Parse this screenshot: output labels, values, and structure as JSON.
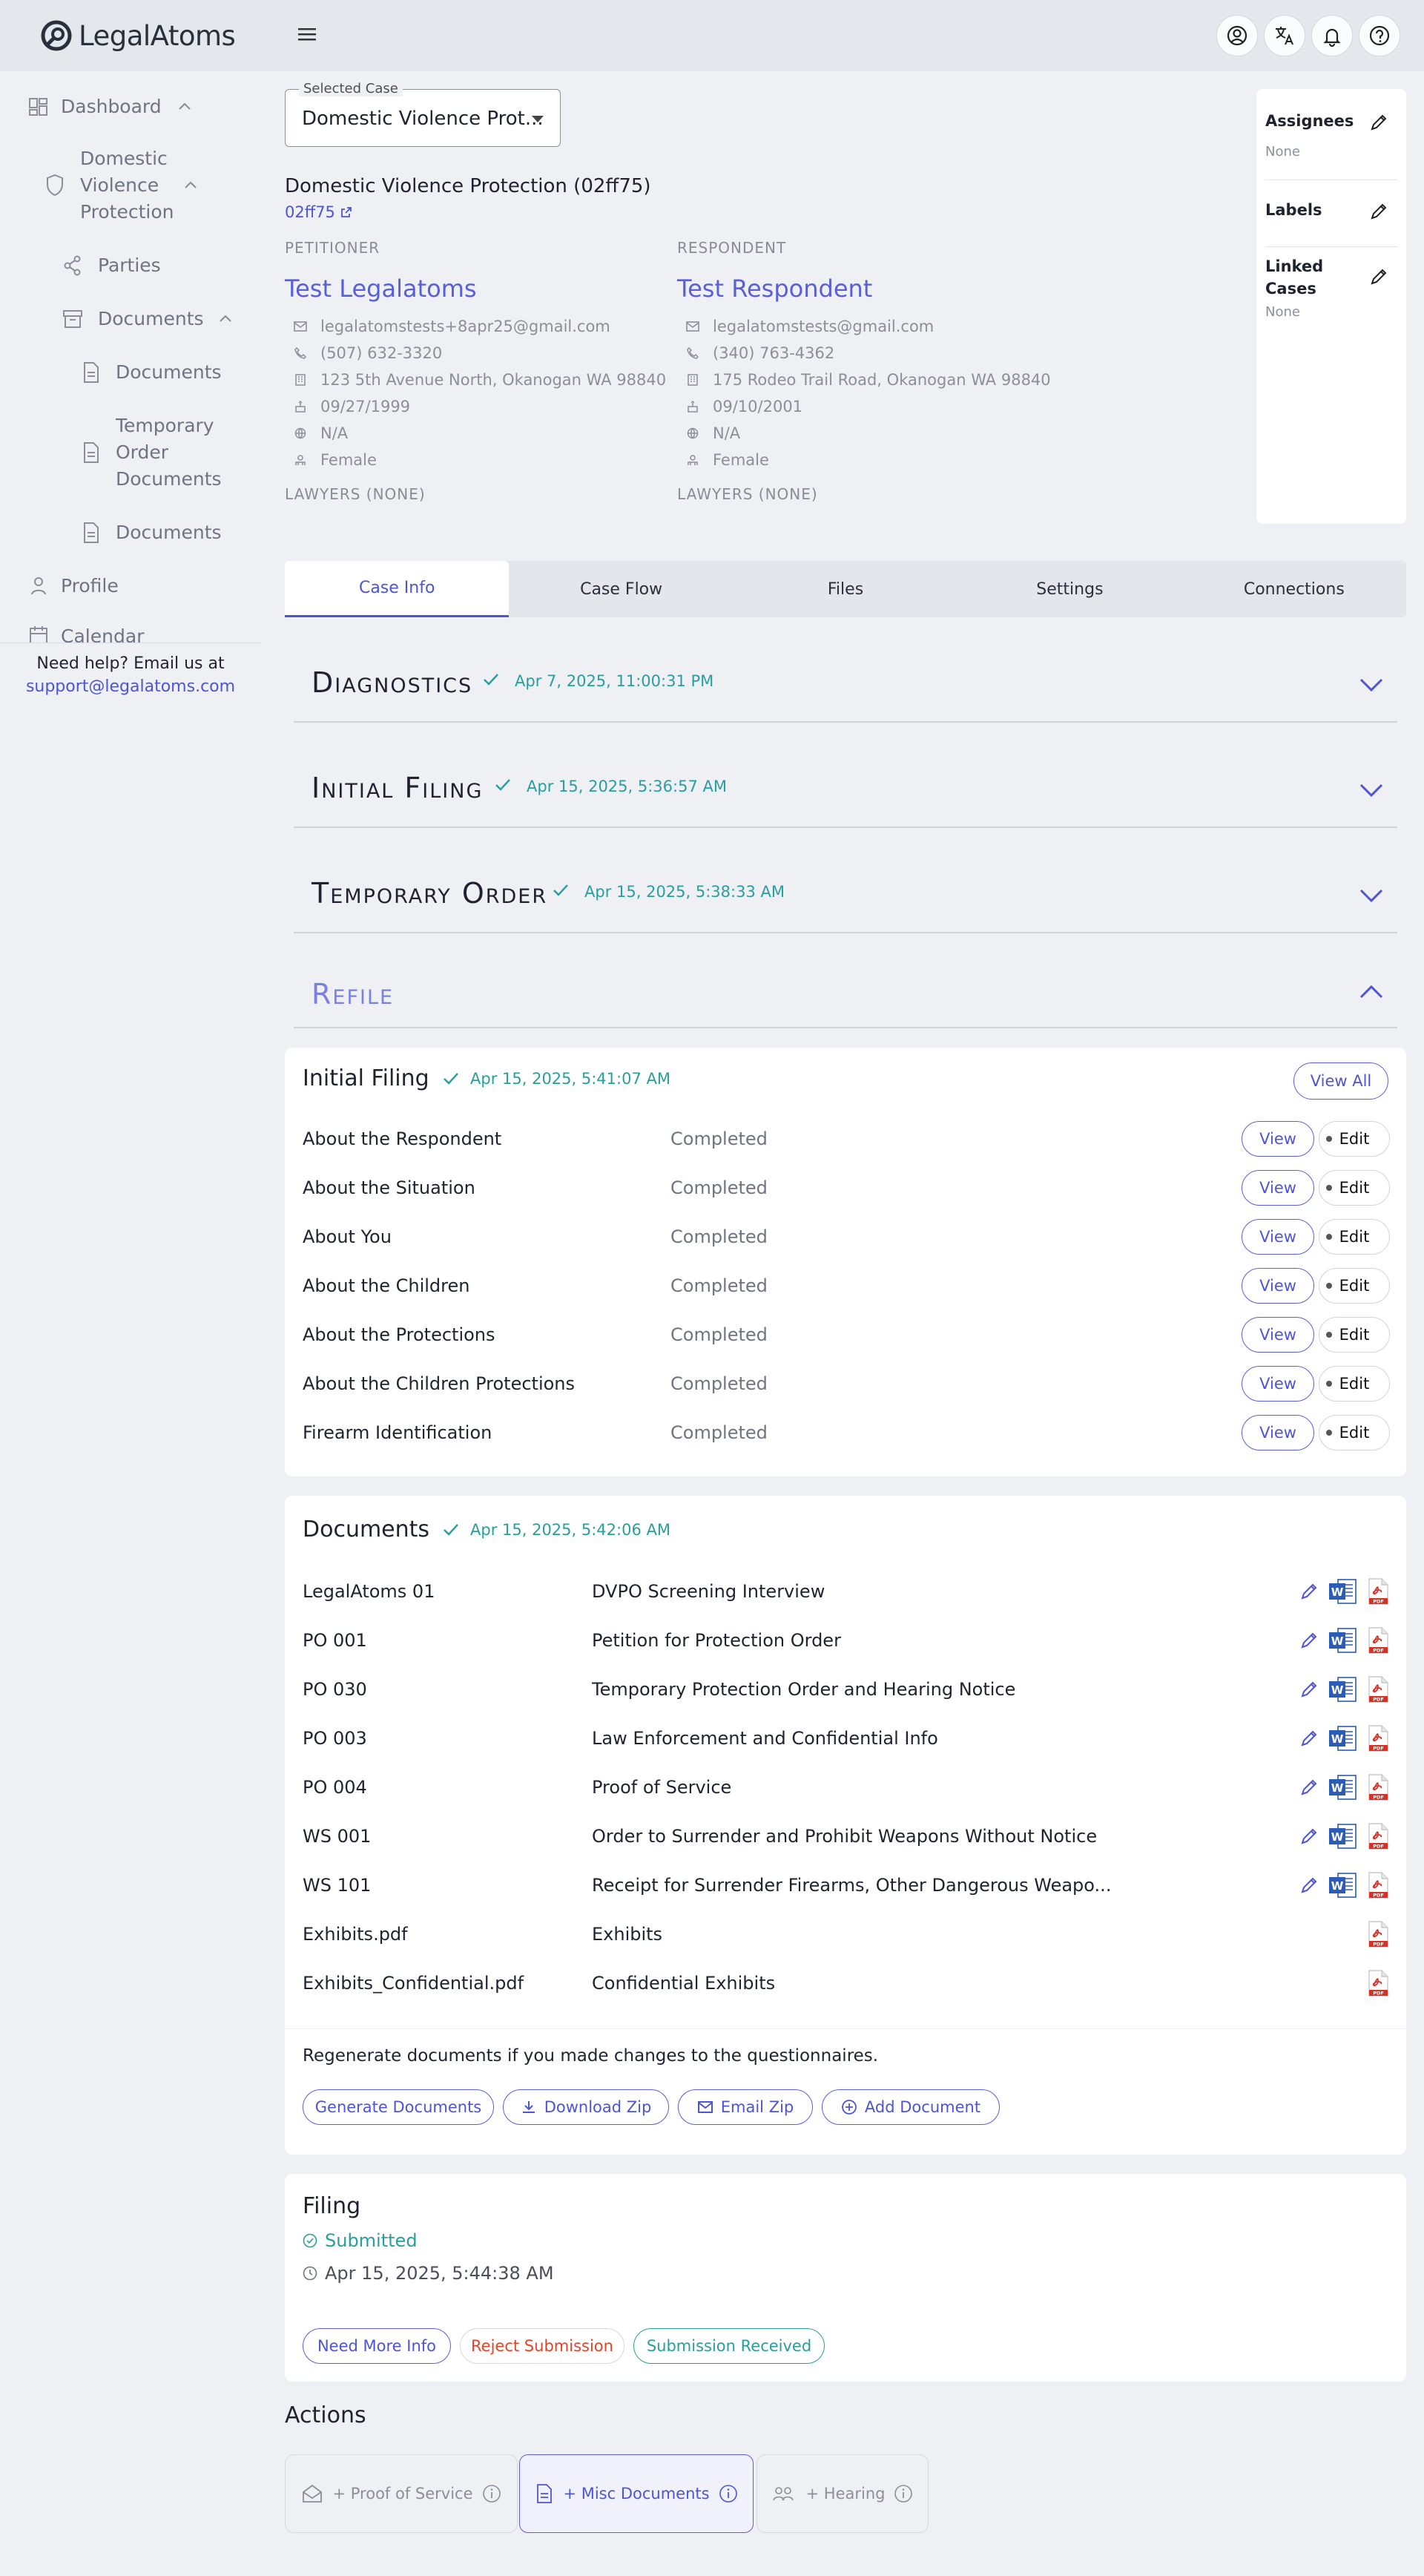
{
  "app": {
    "name": "LegalAtoms"
  },
  "topbar": {
    "icons": [
      "account-circle-icon",
      "translate-icon",
      "bell-icon",
      "help-circle-icon"
    ]
  },
  "sidebar": {
    "dashboard": "Dashboard",
    "case": "Domestic Violence Protection",
    "parties": "Parties",
    "documents": "Documents",
    "doc_children": [
      "Documents",
      "Temporary Order Documents",
      "Documents"
    ],
    "profile": "Profile",
    "calendar": "Calendar",
    "help_text": "Need help? Email us at",
    "help_email": "support@legalatoms.com"
  },
  "case": {
    "select_label": "Selected Case",
    "select_value": "Domestic Violence Prot...",
    "title": "Domestic Violence Protection (02ff75)",
    "code": "02ff75"
  },
  "petitioner": {
    "role": "PETITIONER",
    "name": "Test Legalatoms",
    "email": "legalatomstests+8apr25@gmail.com",
    "phone": "(507) 632-3320",
    "address": "123 5th Avenue North, Okanogan WA 98840",
    "dob": "09/27/1999",
    "language": "N/A",
    "gender": "Female",
    "lawyers": "LAWYERS (NONE)"
  },
  "respondent": {
    "role": "RESPONDENT",
    "name": "Test Respondent",
    "email": "legalatomstests@gmail.com",
    "phone": "(340) 763-4362",
    "address": "175 Rodeo Trail Road, Okanogan WA 98840",
    "dob": "09/10/2001",
    "language": "N/A",
    "gender": "Female",
    "lawyers": "LAWYERS (NONE)"
  },
  "meta": {
    "assignees": "Assignees",
    "assignees_value": "None",
    "labels": "Labels",
    "linked_cases": "Linked Cases",
    "linked_cases_value": "None"
  },
  "tabs": [
    "Case Info",
    "Case Flow",
    "Files",
    "Settings",
    "Connections"
  ],
  "stages": [
    {
      "name": "Diagnostics",
      "date": "Apr 7, 2025, 11:00:31 PM"
    },
    {
      "name": "Initial Filing",
      "date": "Apr 15, 2025, 5:36:57 AM"
    },
    {
      "name": "Temporary Order",
      "date": "Apr 15, 2025, 5:38:33 AM"
    },
    {
      "name": "Refile"
    }
  ],
  "initial_filing": {
    "title": "Initial Filing",
    "date": "Apr 15, 2025, 5:41:07 AM",
    "view_all": "View All",
    "view": "View",
    "edit": "Edit",
    "rows": [
      {
        "name": "About the Respondent",
        "status": "Completed"
      },
      {
        "name": "About the Situation",
        "status": "Completed"
      },
      {
        "name": "About You",
        "status": "Completed"
      },
      {
        "name": "About the Children",
        "status": "Completed"
      },
      {
        "name": "About the Protections",
        "status": "Completed"
      },
      {
        "name": "About the Children Protections",
        "status": "Completed"
      },
      {
        "name": "Firearm Identification",
        "status": "Completed"
      }
    ]
  },
  "documents": {
    "title": "Documents",
    "date": "Apr 15, 2025, 5:42:06 AM",
    "rows": [
      {
        "code": "LegalAtoms 01",
        "name": "DVPO Screening Interview"
      },
      {
        "code": "PO 001",
        "name": "Petition for Protection Order"
      },
      {
        "code": "PO 030",
        "name": "Temporary Protection Order and Hearing Notice"
      },
      {
        "code": "PO 003",
        "name": "Law Enforcement and Confidential Info"
      },
      {
        "code": "PO 004",
        "name": "Proof of Service"
      },
      {
        "code": "WS 001",
        "name": "Order to Surrender and Prohibit Weapons Without Notice"
      },
      {
        "code": "WS 101",
        "name": "Receipt for Surrender Firearms, Other Dangerous Weapo..."
      },
      {
        "code": "Exhibits.pdf",
        "name": "Exhibits"
      },
      {
        "code": "Exhibits_Confidential.pdf",
        "name": "Confidential Exhibits"
      }
    ],
    "regen_text": "Regenerate documents if you made changes to the questionnaires.",
    "generate": "Generate Documents",
    "download_zip": "Download Zip",
    "email_zip": "Email Zip",
    "add_document": "Add Document"
  },
  "filing": {
    "title": "Filing",
    "status": "Submitted",
    "time": "Apr 15, 2025, 5:44:38 AM",
    "need_more_info": "Need More Info",
    "reject": "Reject Submission",
    "received": "Submission Received"
  },
  "actions": {
    "title": "Actions",
    "proof_of_service": "+ Proof of Service",
    "misc_documents": "+ Misc Documents",
    "hearing": "+ Hearing"
  },
  "colors": {
    "accent": "#4e54d6",
    "success": "#2a9d9d",
    "danger": "#e0452a"
  }
}
